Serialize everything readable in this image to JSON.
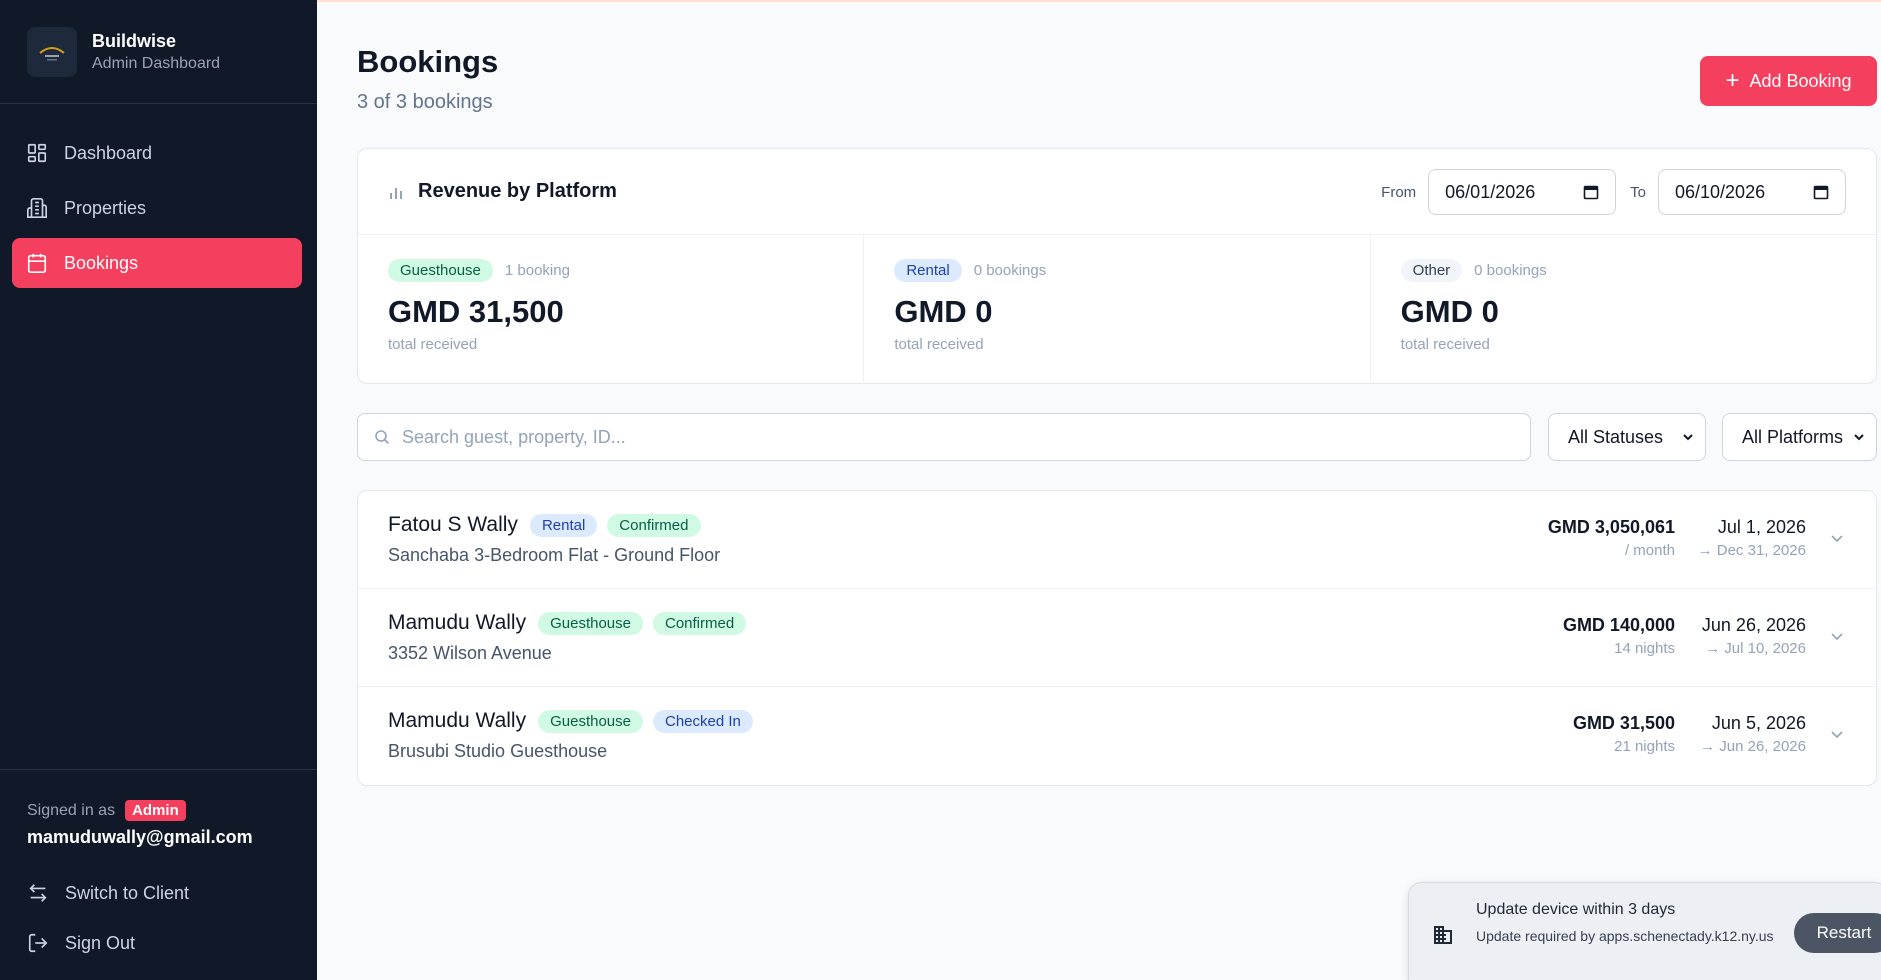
{
  "sidebar": {
    "brand_name": "Buildwise",
    "brand_sub": "Admin Dashboard",
    "nav": [
      {
        "label": "Dashboard",
        "icon": "dashboard-icon"
      },
      {
        "label": "Properties",
        "icon": "building-icon"
      },
      {
        "label": "Bookings",
        "icon": "calendar-icon",
        "active": true
      }
    ],
    "signed_in_as": "Signed in as",
    "role_badge": "Admin",
    "email": "mamuduwally@gmail.com",
    "switch_label": "Switch to Client",
    "signout_label": "Sign Out"
  },
  "header": {
    "title": "Bookings",
    "subtitle": "3 of 3 bookings",
    "add_label": "Add Booking"
  },
  "revenue": {
    "title": "Revenue by Platform",
    "from_label": "From",
    "to_label": "To",
    "from_value": "06/01/2026",
    "to_value": "06/10/2026",
    "platforms": [
      {
        "name": "Guesthouse",
        "count": "1 booking",
        "amount": "GMD 31,500",
        "note": "total received",
        "color": "#d1fae5"
      },
      {
        "name": "Rental",
        "count": "0 bookings",
        "amount": "GMD 0",
        "note": "total received",
        "color": "#dbeafe"
      },
      {
        "name": "Other",
        "count": "0 bookings",
        "amount": "GMD 0",
        "note": "total received",
        "color": "#f1f5f9"
      }
    ]
  },
  "filters": {
    "search_placeholder": "Search guest, property, ID...",
    "status_selected": "All Statuses",
    "platform_selected": "All Platforms"
  },
  "bookings": [
    {
      "guest": "Fatou S Wally",
      "platform": "Rental",
      "status": "Confirmed",
      "property": "Sanchaba 3-Bedroom Flat - Ground Floor",
      "amount": "GMD 3,050,061",
      "unit": "/ month",
      "start": "Jul 1, 2026",
      "end": "→ Dec 31, 2026"
    },
    {
      "guest": "Mamudu Wally",
      "platform": "Guesthouse",
      "status": "Confirmed",
      "property": "3352 Wilson Avenue",
      "amount": "GMD 140,000",
      "unit": "14 nights",
      "start": "Jun 26, 2026",
      "end": "→ Jul 10, 2026"
    },
    {
      "guest": "Mamudu Wally",
      "platform": "Guesthouse",
      "status": "Checked In",
      "property": "Brusubi Studio Guesthouse",
      "amount": "GMD 31,500",
      "unit": "21 nights",
      "start": "Jun 5, 2026",
      "end": "→ Jun 26, 2026"
    }
  ],
  "toast": {
    "title": "Update device within 3 days",
    "body": "Update required by apps.schenectady.k12.ny.us",
    "action": "Restart"
  },
  "colors": {
    "accent": "#f43f5e",
    "sidebar_bg": "#111827",
    "confirmed_bg": "#d1fae5",
    "checked_in_bg": "#dbeafe"
  }
}
